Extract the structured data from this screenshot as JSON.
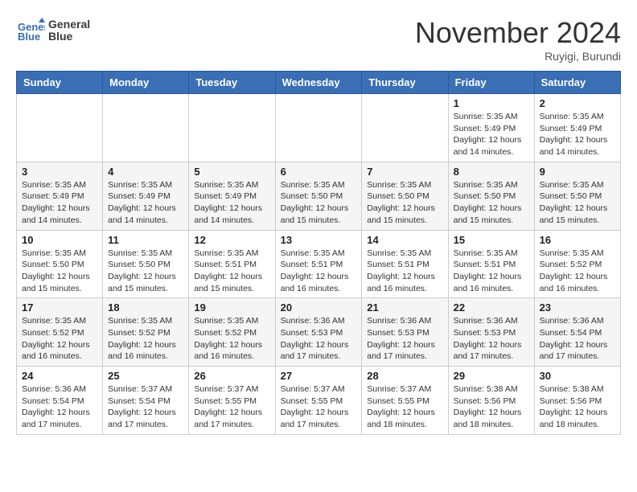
{
  "header": {
    "logo": {
      "line1": "General",
      "line2": "Blue"
    },
    "title": "November 2024",
    "location": "Ruyigi, Burundi"
  },
  "weekdays": [
    "Sunday",
    "Monday",
    "Tuesday",
    "Wednesday",
    "Thursday",
    "Friday",
    "Saturday"
  ],
  "weeks": [
    [
      {
        "day": "",
        "info": ""
      },
      {
        "day": "",
        "info": ""
      },
      {
        "day": "",
        "info": ""
      },
      {
        "day": "",
        "info": ""
      },
      {
        "day": "",
        "info": ""
      },
      {
        "day": "1",
        "info": "Sunrise: 5:35 AM\nSunset: 5:49 PM\nDaylight: 12 hours and 14 minutes."
      },
      {
        "day": "2",
        "info": "Sunrise: 5:35 AM\nSunset: 5:49 PM\nDaylight: 12 hours and 14 minutes."
      }
    ],
    [
      {
        "day": "3",
        "info": "Sunrise: 5:35 AM\nSunset: 5:49 PM\nDaylight: 12 hours and 14 minutes."
      },
      {
        "day": "4",
        "info": "Sunrise: 5:35 AM\nSunset: 5:49 PM\nDaylight: 12 hours and 14 minutes."
      },
      {
        "day": "5",
        "info": "Sunrise: 5:35 AM\nSunset: 5:49 PM\nDaylight: 12 hours and 14 minutes."
      },
      {
        "day": "6",
        "info": "Sunrise: 5:35 AM\nSunset: 5:50 PM\nDaylight: 12 hours and 15 minutes."
      },
      {
        "day": "7",
        "info": "Sunrise: 5:35 AM\nSunset: 5:50 PM\nDaylight: 12 hours and 15 minutes."
      },
      {
        "day": "8",
        "info": "Sunrise: 5:35 AM\nSunset: 5:50 PM\nDaylight: 12 hours and 15 minutes."
      },
      {
        "day": "9",
        "info": "Sunrise: 5:35 AM\nSunset: 5:50 PM\nDaylight: 12 hours and 15 minutes."
      }
    ],
    [
      {
        "day": "10",
        "info": "Sunrise: 5:35 AM\nSunset: 5:50 PM\nDaylight: 12 hours and 15 minutes."
      },
      {
        "day": "11",
        "info": "Sunrise: 5:35 AM\nSunset: 5:50 PM\nDaylight: 12 hours and 15 minutes."
      },
      {
        "day": "12",
        "info": "Sunrise: 5:35 AM\nSunset: 5:51 PM\nDaylight: 12 hours and 15 minutes."
      },
      {
        "day": "13",
        "info": "Sunrise: 5:35 AM\nSunset: 5:51 PM\nDaylight: 12 hours and 16 minutes."
      },
      {
        "day": "14",
        "info": "Sunrise: 5:35 AM\nSunset: 5:51 PM\nDaylight: 12 hours and 16 minutes."
      },
      {
        "day": "15",
        "info": "Sunrise: 5:35 AM\nSunset: 5:51 PM\nDaylight: 12 hours and 16 minutes."
      },
      {
        "day": "16",
        "info": "Sunrise: 5:35 AM\nSunset: 5:52 PM\nDaylight: 12 hours and 16 minutes."
      }
    ],
    [
      {
        "day": "17",
        "info": "Sunrise: 5:35 AM\nSunset: 5:52 PM\nDaylight: 12 hours and 16 minutes."
      },
      {
        "day": "18",
        "info": "Sunrise: 5:35 AM\nSunset: 5:52 PM\nDaylight: 12 hours and 16 minutes."
      },
      {
        "day": "19",
        "info": "Sunrise: 5:35 AM\nSunset: 5:52 PM\nDaylight: 12 hours and 16 minutes."
      },
      {
        "day": "20",
        "info": "Sunrise: 5:36 AM\nSunset: 5:53 PM\nDaylight: 12 hours and 17 minutes."
      },
      {
        "day": "21",
        "info": "Sunrise: 5:36 AM\nSunset: 5:53 PM\nDaylight: 12 hours and 17 minutes."
      },
      {
        "day": "22",
        "info": "Sunrise: 5:36 AM\nSunset: 5:53 PM\nDaylight: 12 hours and 17 minutes."
      },
      {
        "day": "23",
        "info": "Sunrise: 5:36 AM\nSunset: 5:54 PM\nDaylight: 12 hours and 17 minutes."
      }
    ],
    [
      {
        "day": "24",
        "info": "Sunrise: 5:36 AM\nSunset: 5:54 PM\nDaylight: 12 hours and 17 minutes."
      },
      {
        "day": "25",
        "info": "Sunrise: 5:37 AM\nSunset: 5:54 PM\nDaylight: 12 hours and 17 minutes."
      },
      {
        "day": "26",
        "info": "Sunrise: 5:37 AM\nSunset: 5:55 PM\nDaylight: 12 hours and 17 minutes."
      },
      {
        "day": "27",
        "info": "Sunrise: 5:37 AM\nSunset: 5:55 PM\nDaylight: 12 hours and 17 minutes."
      },
      {
        "day": "28",
        "info": "Sunrise: 5:37 AM\nSunset: 5:55 PM\nDaylight: 12 hours and 18 minutes."
      },
      {
        "day": "29",
        "info": "Sunrise: 5:38 AM\nSunset: 5:56 PM\nDaylight: 12 hours and 18 minutes."
      },
      {
        "day": "30",
        "info": "Sunrise: 5:38 AM\nSunset: 5:56 PM\nDaylight: 12 hours and 18 minutes."
      }
    ]
  ]
}
